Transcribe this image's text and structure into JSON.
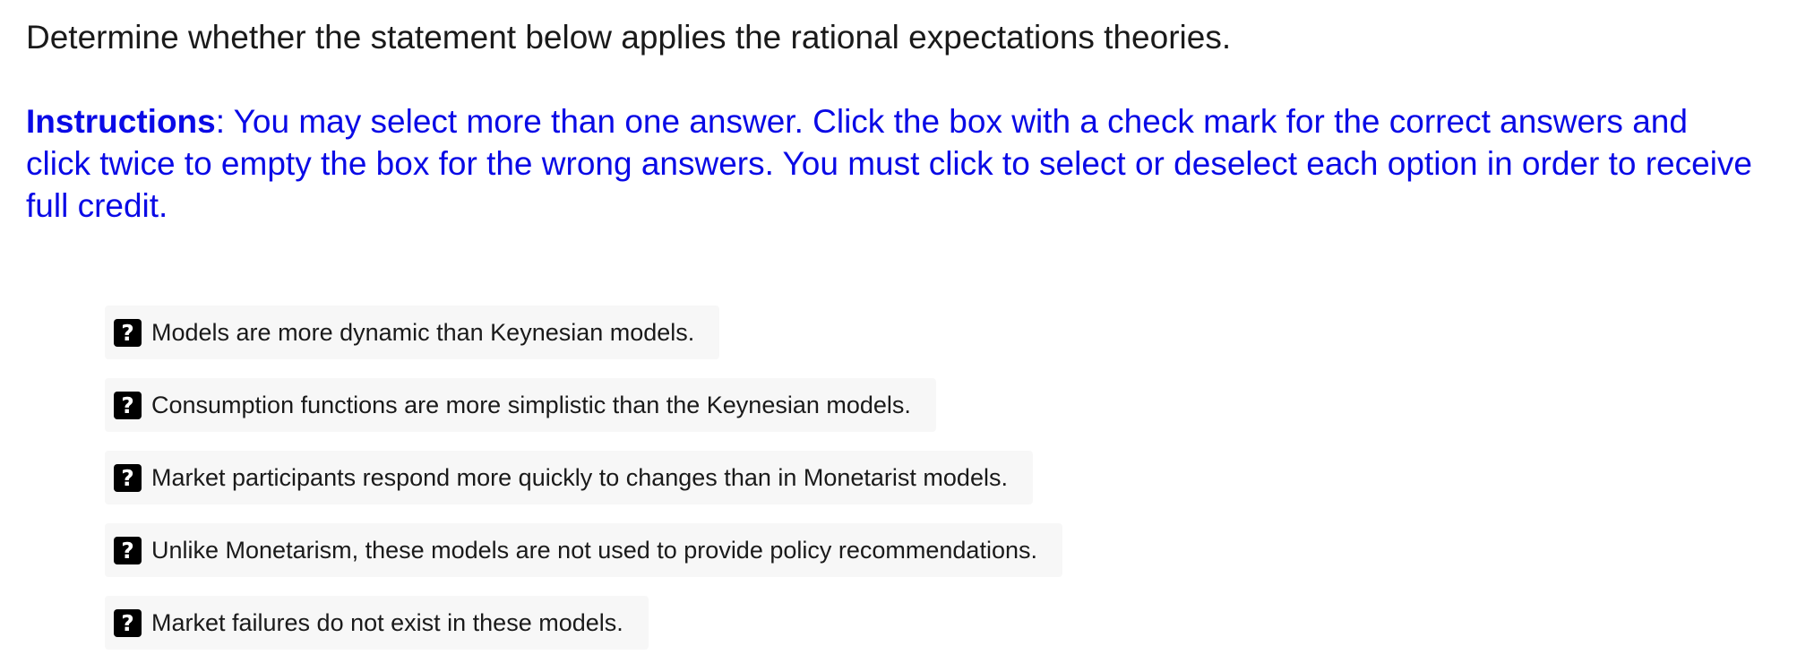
{
  "question": {
    "prompt": "Determine whether the statement below applies the rational expectations theories."
  },
  "instructions": {
    "label": "Instructions",
    "text": ": You may select more than one answer. Click the box with a check mark for the correct answers and click twice to empty the box for the wrong answers. You must click to select or deselect each option in order to receive full credit."
  },
  "options": [
    {
      "box_glyph": "?",
      "state_icon": "question-mark-icon",
      "label": "Models are more dynamic than Keynesian models."
    },
    {
      "box_glyph": "?",
      "state_icon": "question-mark-icon",
      "label": "Consumption functions are more simplistic than the Keynesian models."
    },
    {
      "box_glyph": "?",
      "state_icon": "question-mark-icon",
      "label": "Market participants respond more quickly to changes than in Monetarist models."
    },
    {
      "box_glyph": "?",
      "state_icon": "question-mark-icon",
      "label": "Unlike Monetarism, these models are not used to provide policy recommendations."
    },
    {
      "box_glyph": "?",
      "state_icon": "question-mark-icon",
      "label": "Market failures do not exist in these models."
    }
  ],
  "colors": {
    "instructions_text": "#0a0ae6",
    "option_background": "#f7f7f7",
    "box_background": "#000000"
  }
}
